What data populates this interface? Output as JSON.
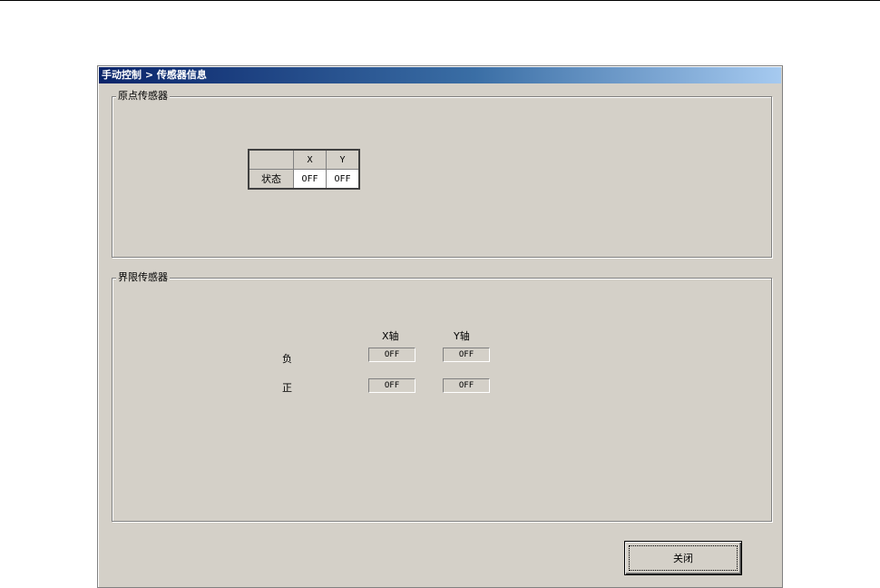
{
  "window": {
    "title": "手动控制 > 传感器信息"
  },
  "origin_sensor": {
    "group_label": "原点传感器",
    "columns": [
      "",
      "X",
      "Y"
    ],
    "row_label": "状态",
    "values": [
      "OFF",
      "OFF"
    ]
  },
  "limit_sensor": {
    "group_label": "界限传感器",
    "col_x": "X轴",
    "col_y": "Y轴",
    "rows": [
      {
        "label": "负",
        "x": "OFF",
        "y": "OFF"
      },
      {
        "label": "正",
        "x": "OFF",
        "y": "OFF"
      }
    ]
  },
  "close_label": "关闭"
}
